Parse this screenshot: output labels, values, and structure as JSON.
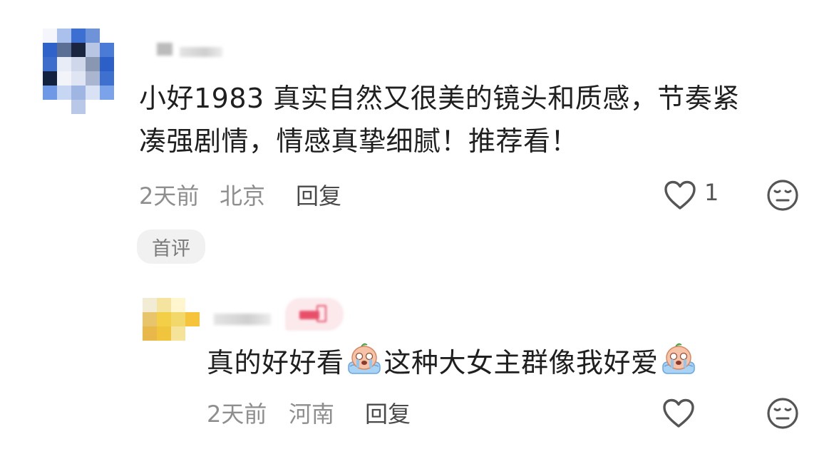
{
  "comments": [
    {
      "text": "小好1983 真实自然又很美的镜头和质感，节奏紧",
      "text_line2": "凑强剧情，情感真挚细腻！推荐看！",
      "time": "2天前",
      "location": "北京",
      "reply_label": "回复",
      "like_count": "1",
      "tag": "首评"
    },
    {
      "text_part1": "真的好好看",
      "text_part2": "这种大女主群像我好爱",
      "time": "2天前",
      "location": "河南",
      "reply_label": "回复",
      "emoji": "crying-emoji"
    }
  ],
  "icons": {
    "like": "heart-outline-icon",
    "reaction": "neutral-face-icon"
  },
  "colors": {
    "text": "#1f1f1f",
    "meta": "#8e8e8e",
    "tag_bg": "#f1f1f1",
    "icon_stroke": "#555555"
  }
}
